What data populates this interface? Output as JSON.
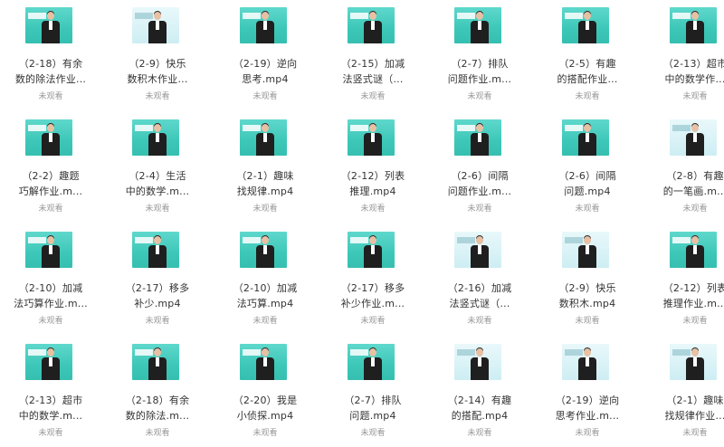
{
  "videos": [
    {
      "line1": "（2-18）有余",
      "line2": "数的除法作业...",
      "status": "未观看",
      "pale": false
    },
    {
      "line1": "（2-9）快乐",
      "line2": "数积木作业...",
      "status": "未观看",
      "pale": true
    },
    {
      "line1": "（2-19）逆向",
      "line2": "思考.mp4",
      "status": "未观看",
      "pale": false
    },
    {
      "line1": "（2-15）加减",
      "line2": "法竖式谜（...",
      "status": "未观看",
      "pale": false
    },
    {
      "line1": "（2-7）排队",
      "line2": "问题作业.m...",
      "status": "未观看",
      "pale": false
    },
    {
      "line1": "（2-5）有趣",
      "line2": "的搭配作业...",
      "status": "未观看",
      "pale": false
    },
    {
      "line1": "（2-13）超市",
      "line2": "中的数学作...",
      "status": "未观看",
      "pale": false
    },
    {
      "line1": "（2-2）趣题",
      "line2": "巧解作业.m...",
      "status": "未观看",
      "pale": false
    },
    {
      "line1": "（2-4）生活",
      "line2": "中的数学.m...",
      "status": "未观看",
      "pale": false
    },
    {
      "line1": "（2-1）趣味",
      "line2": "找规律.mp4",
      "status": "未观看",
      "pale": false
    },
    {
      "line1": "（2-12）列表",
      "line2": "推理.mp4",
      "status": "未观看",
      "pale": false
    },
    {
      "line1": "（2-6）间隔",
      "line2": "问题作业.m...",
      "status": "未观看",
      "pale": false
    },
    {
      "line1": "（2-6）间隔",
      "line2": "问题.mp4",
      "status": "未观看",
      "pale": false
    },
    {
      "line1": "（2-8）有趣",
      "line2": "的一笔画.m...",
      "status": "未观看",
      "pale": true
    },
    {
      "line1": "（2-10）加减",
      "line2": "法巧算作业.m...",
      "status": "未观看",
      "pale": false
    },
    {
      "line1": "（2-17）移多",
      "line2": "补少.mp4",
      "status": "未观看",
      "pale": false
    },
    {
      "line1": "（2-10）加减",
      "line2": "法巧算.mp4",
      "status": "未观看",
      "pale": false
    },
    {
      "line1": "（2-17）移多",
      "line2": "补少作业.m...",
      "status": "未观看",
      "pale": false
    },
    {
      "line1": "（2-16）加减",
      "line2": "法竖式谜（...",
      "status": "未观看",
      "pale": true
    },
    {
      "line1": "（2-9）快乐",
      "line2": "数积木.mp4",
      "status": "未观看",
      "pale": true
    },
    {
      "line1": "（2-12）列表",
      "line2": "推理作业.m...",
      "status": "未观看",
      "pale": false
    },
    {
      "line1": "（2-13）超市",
      "line2": "中的数学.m...",
      "status": "未观看",
      "pale": false
    },
    {
      "line1": "（2-18）有余",
      "line2": "数的除法.m...",
      "status": "未观看",
      "pale": false
    },
    {
      "line1": "（2-20）我是",
      "line2": "小侦探.mp4",
      "status": "未观看",
      "pale": false
    },
    {
      "line1": "（2-7）排队",
      "line2": "问题.mp4",
      "status": "未观看",
      "pale": false
    },
    {
      "line1": "（2-14）有趣",
      "line2": "的搭配.mp4",
      "status": "未观看",
      "pale": true
    },
    {
      "line1": "（2-19）逆向",
      "line2": "思考作业.m...",
      "status": "未观看",
      "pale": true
    },
    {
      "line1": "（2-1）趣味",
      "line2": "找规律作业...",
      "status": "未观看",
      "pale": true
    }
  ]
}
